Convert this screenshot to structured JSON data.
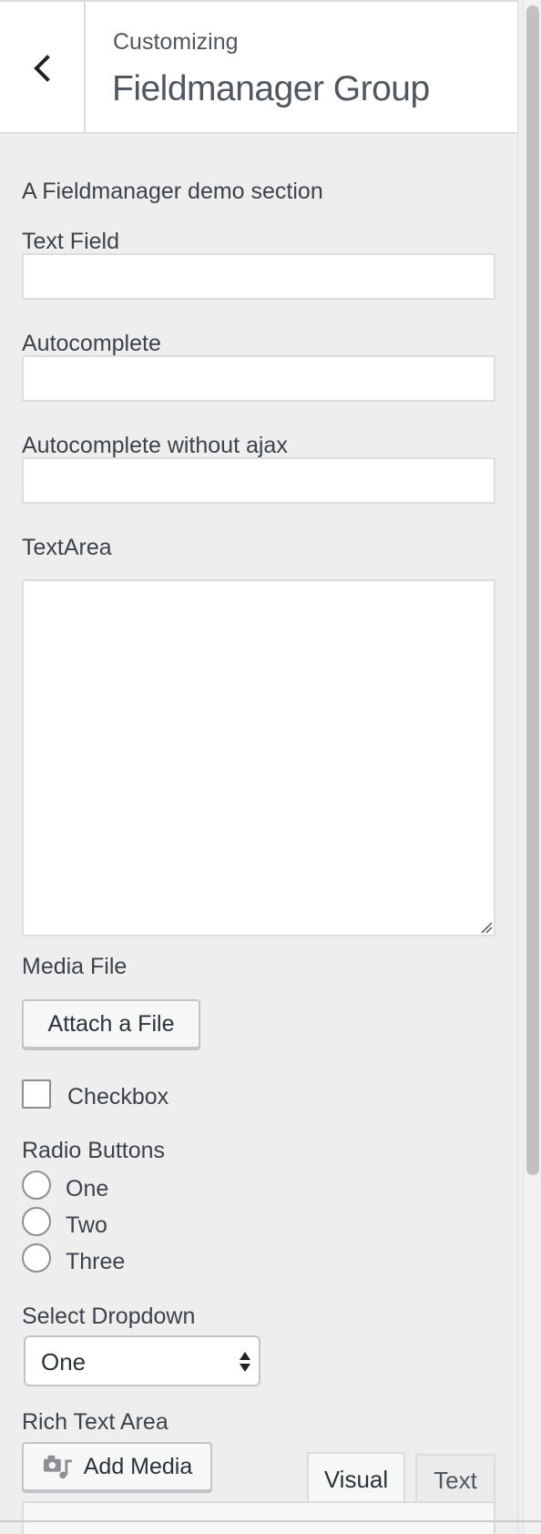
{
  "header": {
    "back_label": "Back",
    "subtitle": "Customizing",
    "title": "Fieldmanager Group"
  },
  "section": {
    "description": "A Fieldmanager demo section",
    "text_field": {
      "label": "Text Field",
      "value": ""
    },
    "autocomplete": {
      "label": "Autocomplete",
      "value": ""
    },
    "autocomplete_no_ajax": {
      "label": "Autocomplete without ajax",
      "value": ""
    },
    "textarea": {
      "label": "TextArea",
      "value": ""
    },
    "media_file": {
      "label": "Media File",
      "button": "Attach a File"
    },
    "checkbox": {
      "label": "Checkbox",
      "checked": false
    },
    "radio": {
      "label": "Radio Buttons",
      "options": [
        "One",
        "Two",
        "Three"
      ]
    },
    "select": {
      "label": "Select Dropdown",
      "selected": "One"
    },
    "rich_text": {
      "label": "Rich Text Area",
      "add_media": "Add Media",
      "tabs": [
        "Visual",
        "Text"
      ],
      "active_tab": "Visual"
    }
  },
  "colors": {
    "panel_bg": "#eeeeee",
    "header_bg": "#ffffff",
    "text": "#3c434a"
  },
  "icons": {
    "back": "chevron-left-icon",
    "add_media": "media-camera-music-icon"
  }
}
